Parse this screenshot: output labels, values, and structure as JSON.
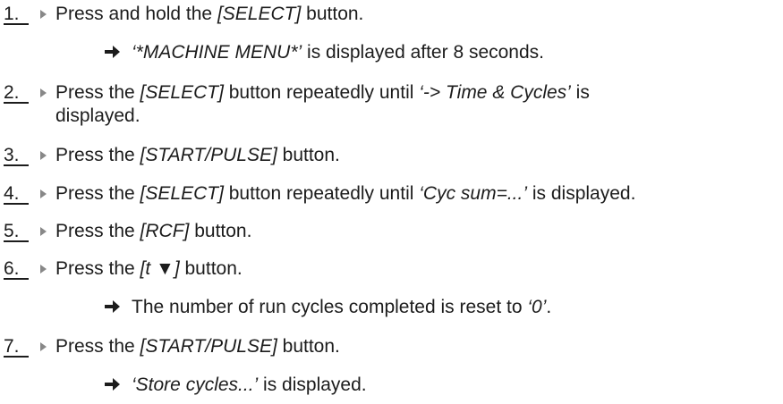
{
  "steps": [
    {
      "number": "1.",
      "text": {
        "pre": "Press and hold the ",
        "em": "[SELECT]",
        "post": " button."
      },
      "result": {
        "pre": "",
        "em": "‘*MACHINE MENU*’",
        "post": " is displayed after 8 seconds."
      }
    },
    {
      "number": "2.",
      "text": {
        "pre": "Press the ",
        "em": "[SELECT]",
        "post": " button repeatedly until ",
        "em2": "‘-> Time & Cycles’",
        "post2": " is"
      },
      "text_cont": "displayed."
    },
    {
      "number": "3.",
      "text": {
        "pre": "Press the ",
        "em": "[START/PULSE]",
        "post": " button."
      }
    },
    {
      "number": "4.",
      "text": {
        "pre": "Press the ",
        "em": "[SELECT]",
        "post": " button repeatedly until ",
        "em2": "‘Cyc sum=...’",
        "post2": " is displayed."
      }
    },
    {
      "number": "5.",
      "text": {
        "pre": "Press the ",
        "em": "[RCF]",
        "post": " button."
      }
    },
    {
      "number": "6.",
      "text": {
        "pre": "Press the ",
        "em": "[t ▼]",
        "post": " button."
      },
      "result": {
        "pre": "The number of run cycles completed is reset to ",
        "em": "‘0’",
        "post": "."
      }
    },
    {
      "number": "7.",
      "text": {
        "pre": "Press the ",
        "em": "[START/PULSE]",
        "post": " button."
      },
      "result": {
        "pre": "",
        "em": "‘Store cycles...’",
        "post": " is displayed."
      }
    }
  ],
  "icons": {
    "step_marker": "triangle-right-icon",
    "result_marker": "arrow-right-icon"
  },
  "colors": {
    "text": "#1c1c1c",
    "step_marker": "#888888"
  }
}
